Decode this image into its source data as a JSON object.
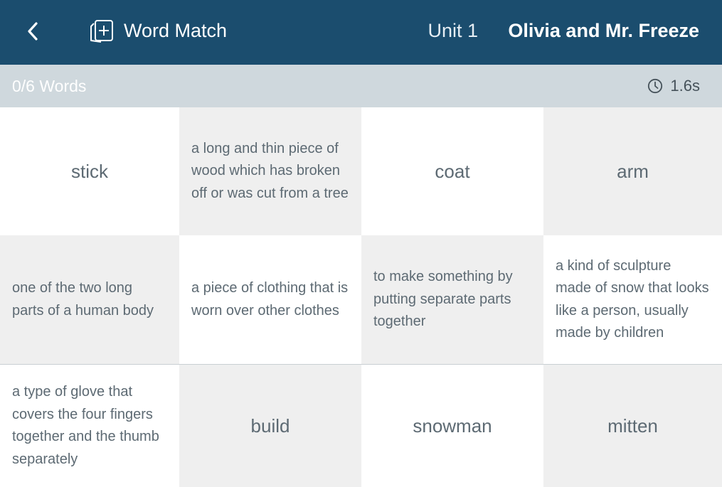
{
  "header": {
    "app_title": "Word Match",
    "unit": "Unit 1",
    "story_title": "Olivia and Mr. Freeze",
    "colors": {
      "background": "#1b4d6e",
      "text": "#ffffff"
    },
    "icons": {
      "back": "chevron-left-icon",
      "app": "add-card-icon"
    }
  },
  "status": {
    "progress": "0/6 Words",
    "timer": "1.6s",
    "timer_icon": "clock-icon",
    "colors": {
      "background": "#cfd8dd"
    }
  },
  "cards": [
    {
      "text": "stick",
      "kind": "word"
    },
    {
      "text": "a long and thin piece of wood which has broken off or was cut from a tree",
      "kind": "definition"
    },
    {
      "text": "coat",
      "kind": "word"
    },
    {
      "text": "arm",
      "kind": "word"
    },
    {
      "text": "one of the two long parts of a human body",
      "kind": "definition"
    },
    {
      "text": "a piece of clothing that is worn over other clothes",
      "kind": "definition"
    },
    {
      "text": "to make something by putting separate parts together",
      "kind": "definition"
    },
    {
      "text": "a kind of sculpture made of snow that looks like a person, usually made by children",
      "kind": "definition"
    },
    {
      "text": "a type of glove that covers the four fingers together and the thumb separately",
      "kind": "definition"
    },
    {
      "text": "build",
      "kind": "word"
    },
    {
      "text": "snowman",
      "kind": "word"
    },
    {
      "text": "mitten",
      "kind": "word"
    }
  ]
}
